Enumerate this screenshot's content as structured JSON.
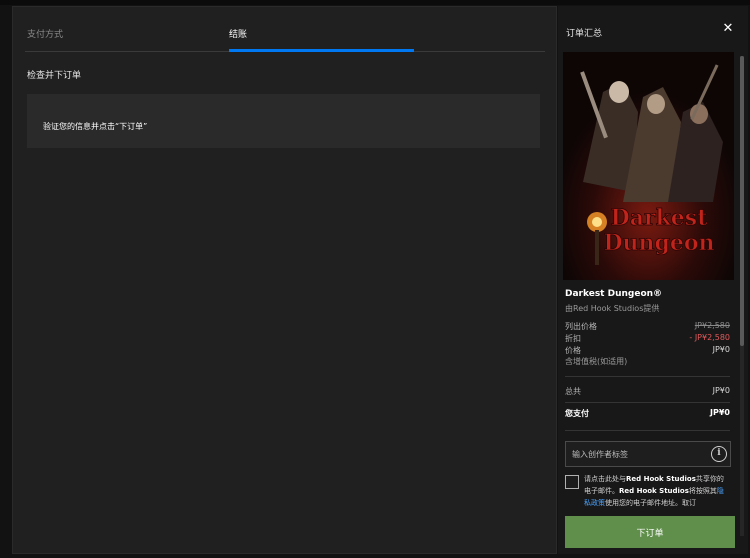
{
  "left_panel": {
    "tabs": [
      {
        "label": "支付方式",
        "active": false
      },
      {
        "label": "结账",
        "active": true
      }
    ],
    "section_title": "检查并下订单",
    "info_message": "验证您的信息并点击“下订单”"
  },
  "summary": {
    "title": "订单汇总",
    "close_icon": "close-icon",
    "game": {
      "title": "Darkest Dungeon®",
      "publisher": "由Red Hook Studios提供",
      "cover_logo_text": "Darkest Dungeon"
    },
    "prices": [
      {
        "label": "列出价格",
        "value": "JP¥2,580",
        "style": "strike"
      },
      {
        "label": "折扣",
        "value": "- JP¥2,580",
        "style": "discount"
      },
      {
        "label": "价格",
        "value": "JP¥0",
        "style": "normal"
      }
    ],
    "vat_note": "含增值税(如适用)",
    "total": {
      "label": "总共",
      "value": "JP¥0"
    },
    "you_pay": {
      "label": "您支付",
      "value": "JP¥0"
    },
    "creator_tag_placeholder": "输入创作者标签",
    "consent": {
      "p1": "请点击此处与",
      "studio1": "Red Hook Studios",
      "p2": "共享你的电子邮件。",
      "studio2": "Red Hook Studios",
      "p3": "将按照其",
      "link": "隐私政策",
      "p4": "使用您的电子邮件地址。取订"
    },
    "place_order_label": "下订单"
  },
  "colors": {
    "accent": "#0078f2",
    "order_button": "#5f8f4a",
    "discount": "#e0595a"
  }
}
